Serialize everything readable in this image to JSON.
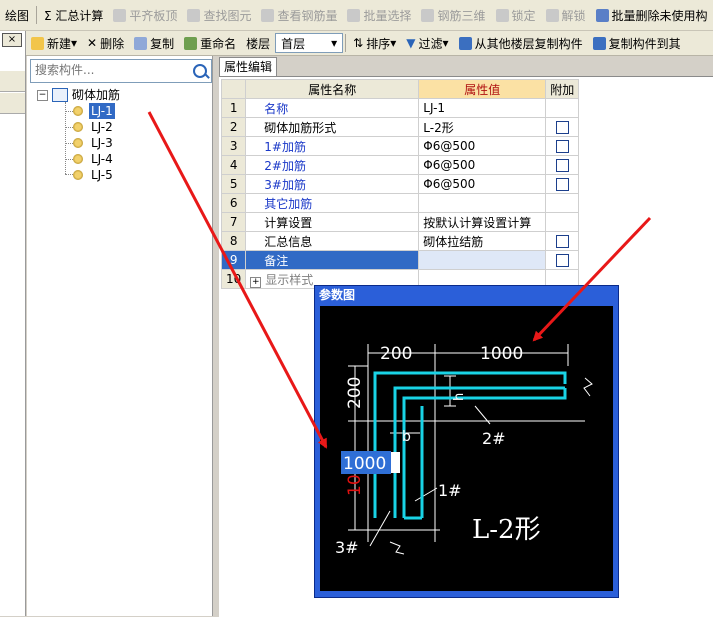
{
  "toolbar1": {
    "items": [
      {
        "label": "绘图",
        "disabled": false
      },
      {
        "label": "Σ 汇总计算",
        "disabled": false
      },
      {
        "label": "平齐板顶",
        "disabled": true
      },
      {
        "label": "查找图元",
        "disabled": true
      },
      {
        "label": "查看钢筋量",
        "disabled": true
      },
      {
        "label": "批量选择",
        "disabled": true
      },
      {
        "label": "钢筋三维",
        "disabled": true
      },
      {
        "label": "锁定",
        "disabled": true
      },
      {
        "label": "解锁",
        "disabled": true
      },
      {
        "label": "批量删除未使用构",
        "disabled": false
      }
    ]
  },
  "toolbar2": {
    "new_label": "新建",
    "delete_label": "删除",
    "copy_label": "复制",
    "rename_label": "重命名",
    "floor_label": "楼层",
    "floor_value": "首层",
    "sort_label": "排序",
    "filter_label": "过滤",
    "copy_from_label": "从其他楼层复制构件",
    "copy_to_label": "复制构件到其"
  },
  "left_strip": {
    "close_glyph": "×"
  },
  "tree": {
    "search_placeholder": "搜索构件...",
    "root_label": "砌体加筋",
    "items": [
      "LJ-1",
      "LJ-2",
      "LJ-3",
      "LJ-4",
      "LJ-5"
    ],
    "selected": "LJ-1"
  },
  "properties": {
    "tab_label": "属性编辑",
    "headers": {
      "name": "属性名称",
      "value": "属性值",
      "extra": "附加"
    },
    "rows": [
      {
        "num": "1",
        "name": "名称",
        "value": "LJ-1",
        "blue": true,
        "check": false
      },
      {
        "num": "2",
        "name": "砌体加筋形式",
        "value": "L-2形",
        "blue": false,
        "check": true
      },
      {
        "num": "3",
        "name": "1#加筋",
        "value": "Φ6@500",
        "blue": true,
        "check": true
      },
      {
        "num": "4",
        "name": "2#加筋",
        "value": "Φ6@500",
        "blue": true,
        "check": true
      },
      {
        "num": "5",
        "name": "3#加筋",
        "value": "Φ6@500",
        "blue": true,
        "check": true
      },
      {
        "num": "6",
        "name": "其它加筋",
        "value": "",
        "blue": true,
        "check": false
      },
      {
        "num": "7",
        "name": "计算设置",
        "value": "按默认计算设置计算",
        "blue": false,
        "check": false
      },
      {
        "num": "8",
        "name": "汇总信息",
        "value": "砌体拉结筋",
        "blue": false,
        "check": true
      },
      {
        "num": "9",
        "name": "备注",
        "value": "",
        "blue": false,
        "check": true
      },
      {
        "num": "10",
        "name": "显示样式",
        "value": "",
        "blue": false,
        "check": false
      }
    ],
    "selected_row": "9"
  },
  "popup": {
    "title": "参数图",
    "dim_top_left": "200",
    "dim_top_right": "1000",
    "dim_left_upper": "200",
    "dim_left_lower": "10",
    "h_label": "h",
    "b_label": "b",
    "bar1_label": "1#",
    "bar2_label": "2#",
    "bar3_label": "3#",
    "form_label": "L-2形",
    "edit_value": "1000",
    "colors": {
      "bar": "#19d3e6",
      "dim": "#ffffff",
      "edit_bg": "#2f6fd6",
      "red": "#e01010"
    }
  },
  "annotation_color": "#e81818"
}
